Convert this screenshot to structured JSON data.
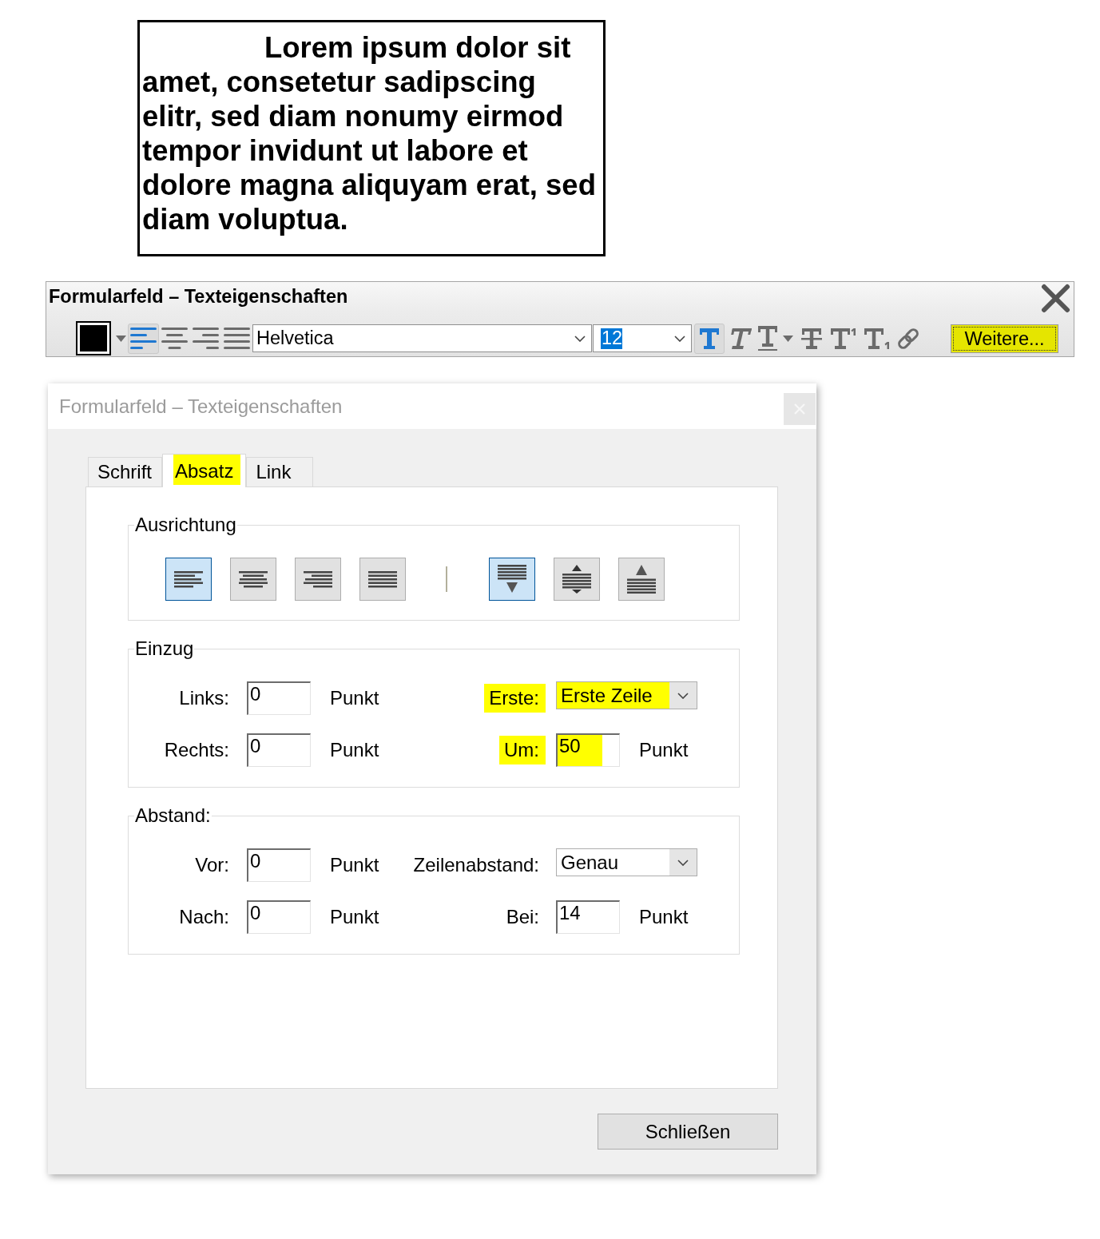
{
  "text_field": {
    "text": "Lorem ipsum dolor sit amet, consetetur sadipscing elitr, sed diam nonumy eirmod tempor invidunt ut labore et dolore magna aliquyam erat, sed diam voluptua."
  },
  "toolbar": {
    "title": "Formularfeld – Texteigenschaften",
    "text_color": {
      "color": "#000000"
    },
    "alignment": [
      {
        "kind": "left",
        "selected": true
      },
      {
        "kind": "center",
        "selected": false
      },
      {
        "kind": "right",
        "selected": false
      },
      {
        "kind": "justify",
        "selected": false
      }
    ],
    "font": "Helvetica",
    "size": {
      "value": "12",
      "text_selected": true
    },
    "styles": [
      {
        "kind": "bold",
        "selected": true
      },
      {
        "kind": "italic",
        "selected": false
      },
      {
        "kind": "underline",
        "selected": false
      },
      {
        "kind": "strikethrough",
        "selected": false
      },
      {
        "kind": "superscript",
        "selected": false
      },
      {
        "kind": "subscript",
        "selected": false
      },
      {
        "kind": "link",
        "selected": false
      }
    ],
    "more_button": {
      "label": "Weitere...",
      "highlighted": true
    }
  },
  "dialog": {
    "title": "Formularfeld – Texteigenschaften",
    "tabs": [
      {
        "label": "Schrift",
        "selected": false,
        "highlighted": false
      },
      {
        "label": "Absatz",
        "selected": true,
        "highlighted": true
      },
      {
        "label": "Link",
        "selected": false,
        "highlighted": false
      }
    ],
    "alignment_group": {
      "title": "Ausrichtung",
      "horizontal": [
        {
          "kind": "left",
          "selected": true
        },
        {
          "kind": "center",
          "selected": false
        },
        {
          "kind": "right",
          "selected": false
        },
        {
          "kind": "justify",
          "selected": false
        }
      ],
      "vertical": [
        {
          "kind": "top",
          "selected": true
        },
        {
          "kind": "middle",
          "selected": false
        },
        {
          "kind": "bottom",
          "selected": false
        }
      ]
    },
    "indent_group": {
      "title": "Einzug",
      "rows": [
        {
          "left": {
            "kind": "number",
            "label": "Links:",
            "value": "0",
            "unit": "Punkt",
            "highlighted": false
          },
          "right": {
            "kind": "dropdown",
            "label": "Erste:",
            "value": "Erste Zeile",
            "highlighted": true
          }
        },
        {
          "left": {
            "kind": "number",
            "label": "Rechts:",
            "value": "0",
            "unit": "Punkt",
            "highlighted": false
          },
          "right": {
            "kind": "number",
            "label": "Um:",
            "value": "50",
            "unit": "Punkt",
            "highlighted": true
          }
        }
      ]
    },
    "spacing_group": {
      "title": "Abstand:",
      "rows": [
        {
          "left": {
            "kind": "number",
            "label": "Vor:",
            "value": "0",
            "unit": "Punkt",
            "highlighted": false
          },
          "right": {
            "kind": "dropdown",
            "label": "Zeilenabstand:",
            "value": "Genau",
            "highlighted": false
          }
        },
        {
          "left": {
            "kind": "number",
            "label": "Nach:",
            "value": "0",
            "unit": "Punkt",
            "highlighted": false
          },
          "right": {
            "kind": "number",
            "label": "Bei:",
            "value": "14",
            "unit": "Punkt",
            "highlighted": false
          }
        }
      ]
    },
    "close_button": "Schließen"
  }
}
